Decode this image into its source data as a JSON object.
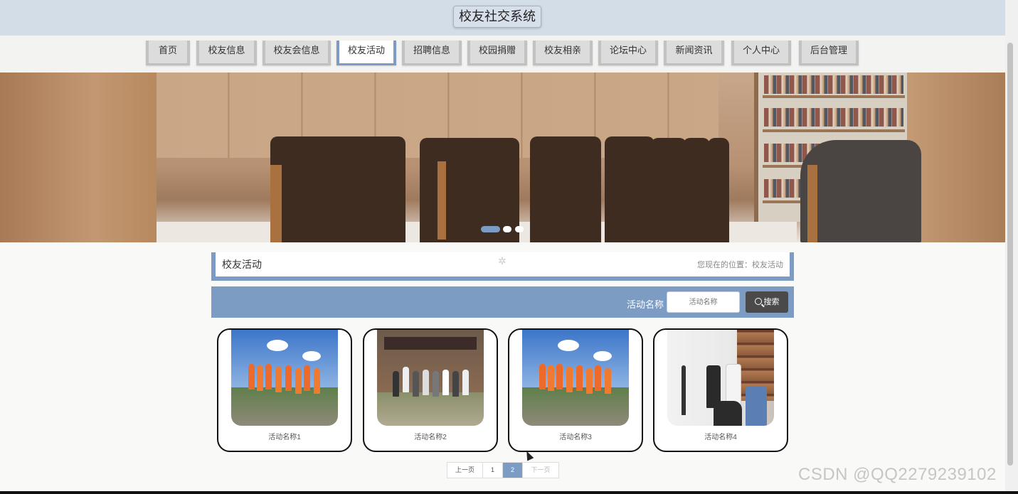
{
  "header": {
    "title": "校友社交系统"
  },
  "nav": {
    "items": [
      "首页",
      "校友信息",
      "校友会信息",
      "校友活动",
      "招聘信息",
      "校园捐赠",
      "校友相亲",
      "论坛中心",
      "新闻资讯",
      "个人中心",
      "后台管理"
    ],
    "active_index": 3
  },
  "banner": {
    "slide_count": 3,
    "active_slide": 1
  },
  "content": {
    "title": "校友活动",
    "location": "您现在的位置：校友活动"
  },
  "search": {
    "label": "活动名称",
    "placeholder": "活动名称",
    "button": "搜索"
  },
  "cards": [
    {
      "name": "活动名称1",
      "image": "group-photo-orange-vests"
    },
    {
      "name": "活动名称2",
      "image": "group-photo-temple"
    },
    {
      "name": "活动名称3",
      "image": "group-photo-orange-vests"
    },
    {
      "name": "活动名称4",
      "image": "office-meeting"
    }
  ],
  "pagination": {
    "prev": "上一页",
    "pages": [
      "1",
      "2"
    ],
    "current": "2",
    "next": "下一页"
  },
  "watermark": "CSDN @QQ2279239102",
  "colors": {
    "accent": "#7d9cc4",
    "header_bg": "#d2dde8",
    "search_button": "#4a4a4a"
  }
}
